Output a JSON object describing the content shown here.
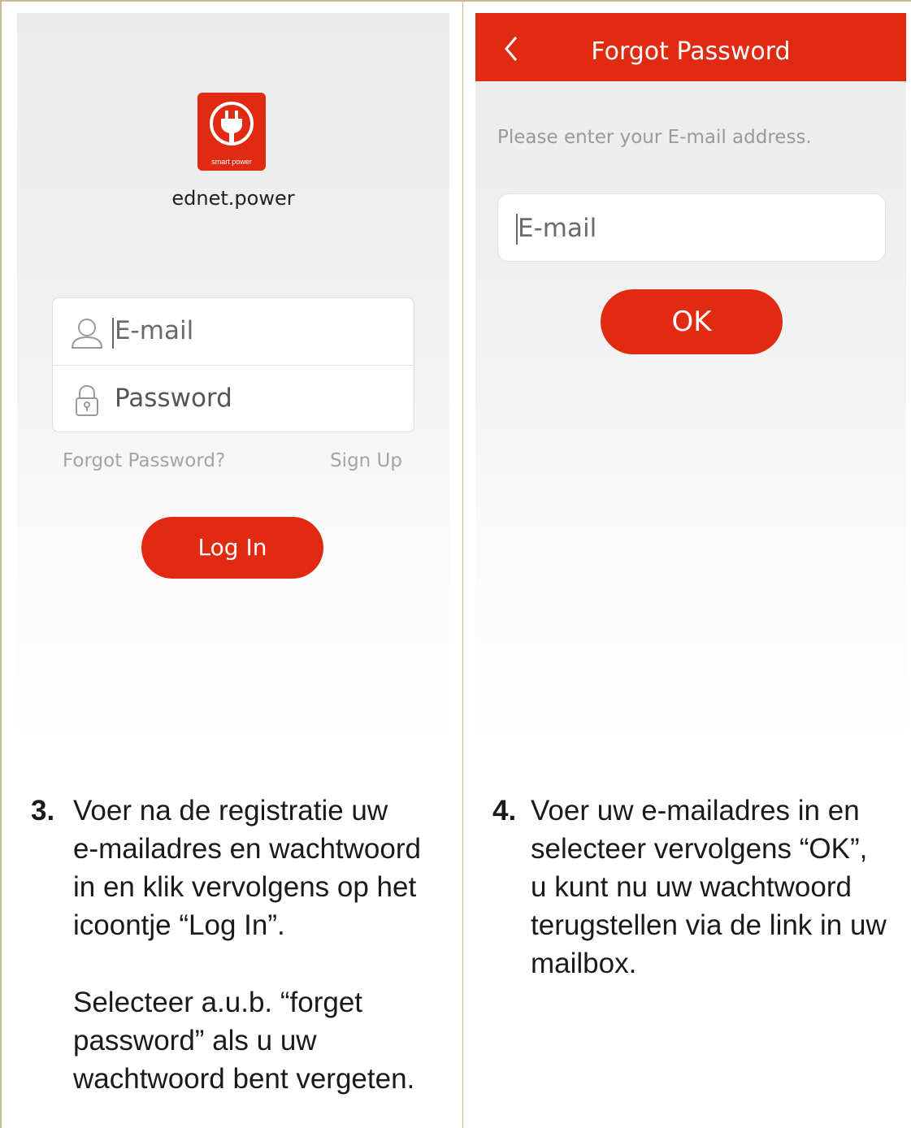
{
  "login_screen": {
    "logo_text": "smart power",
    "app_name": "ednet.power",
    "email_placeholder": "E-mail",
    "password_placeholder": "Password",
    "forgot_link": "Forgot Password?",
    "signup_link": "Sign Up",
    "login_button": "Log In"
  },
  "forgot_screen": {
    "title": "Forgot Password",
    "instruction": "Please enter your E-mail address.",
    "email_placeholder": "E-mail",
    "ok_button": "OK"
  },
  "steps": [
    {
      "number": "3.",
      "lines": [
        "Voer na de registratie uw",
        "e-mailadres en wachtwoord",
        "in en klik vervolgens op het",
        "icoontje “Log In”."
      ],
      "note_lines": [
        "Selecteer a.u.b. “forget",
        "password” als u uw",
        "wachtwoord bent vergeten."
      ]
    },
    {
      "number": "4.",
      "lines": [
        "Voer uw e-mailadres in en",
        "selecteer vervolgens “OK”,",
        "u kunt nu uw wachtwoord",
        "terugstellen via de link in uw",
        "mailbox."
      ]
    }
  ],
  "colors": {
    "brand_red": "#e02a12",
    "frame": "#c9b98f"
  }
}
